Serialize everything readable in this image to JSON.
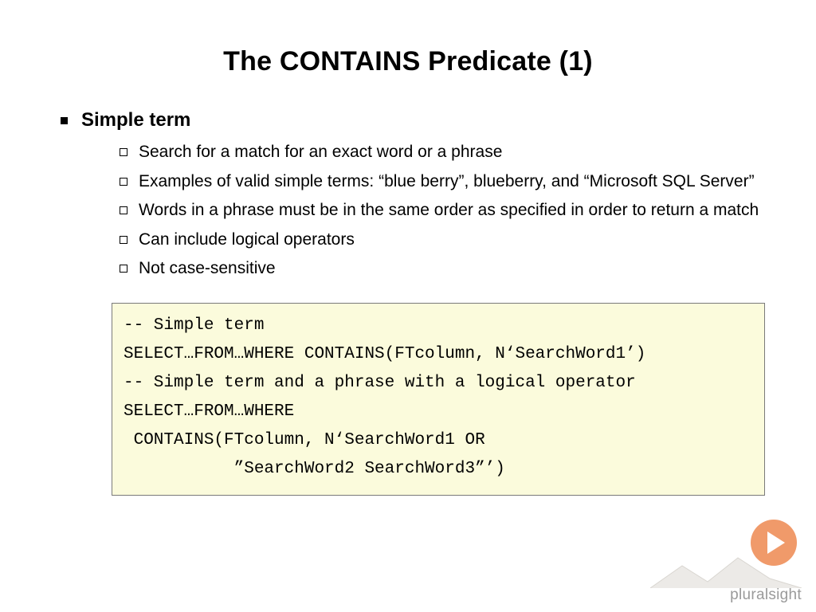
{
  "title": "The CONTAINS Predicate (1)",
  "section": {
    "heading": "Simple term",
    "bullets": [
      "Search for a match for an exact word or a phrase",
      "Examples of valid simple terms: “blue berry”, blueberry, and “Microsoft SQL Server”",
      "Words in a phrase must be in the same order as specified in order to return a match",
      "Can include logical operators",
      "Not case-sensitive"
    ]
  },
  "code": "-- Simple term\nSELECT…FROM…WHERE CONTAINS(FTcolumn, N‘SearchWord1’)\n-- Simple term and a phrase with a logical operator\nSELECT…FROM…WHERE\n CONTAINS(FTcolumn, N‘SearchWord1 OR\n           ”SearchWord2 SearchWord3”’)",
  "brand": "pluralsight"
}
